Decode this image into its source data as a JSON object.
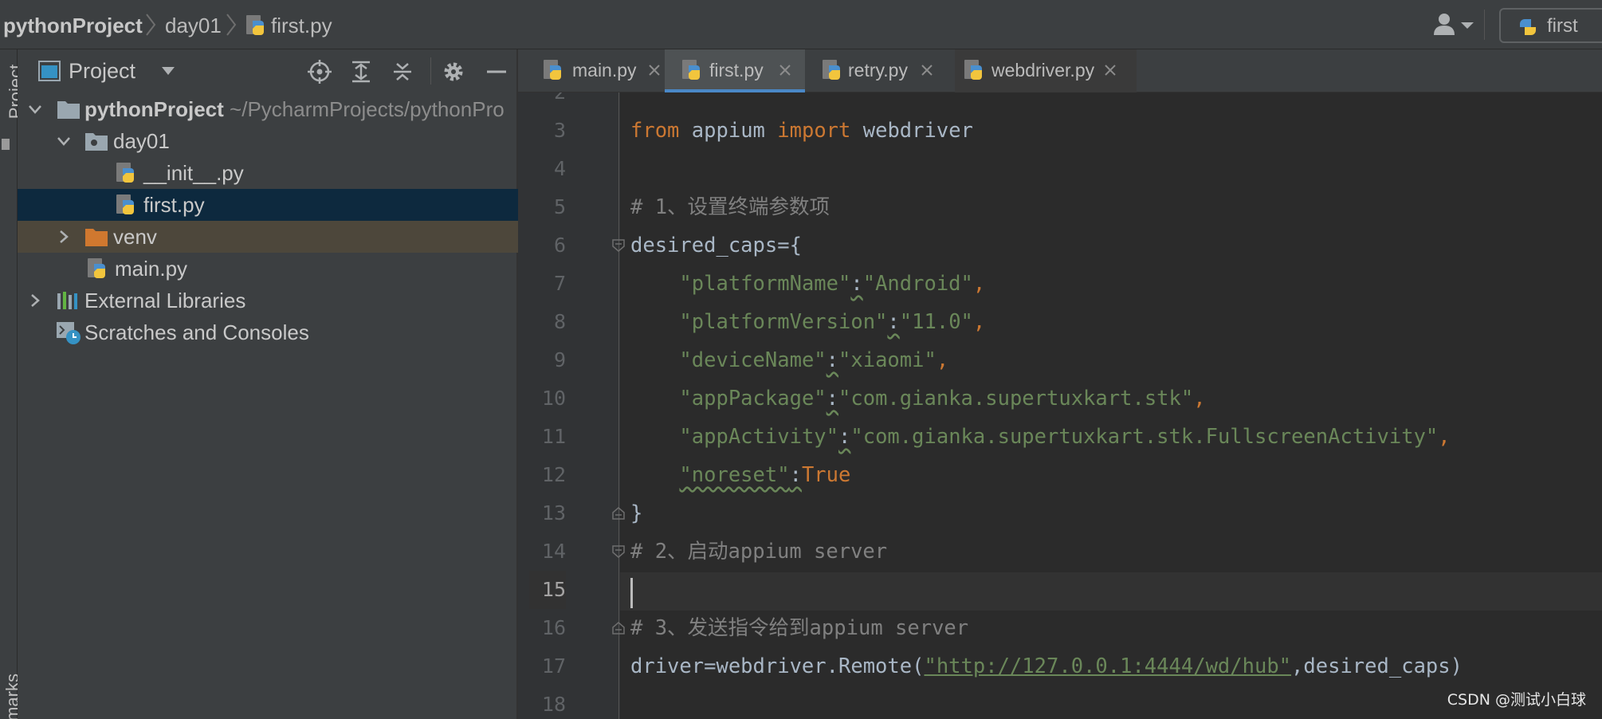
{
  "breadcrumb": {
    "project": "pythonProject",
    "folder": "day01",
    "file": "first.py"
  },
  "run_config": {
    "label": "first"
  },
  "left_stripe": {
    "project_label": "Project",
    "bookmarks_label": "marks"
  },
  "project_panel": {
    "title": "Project",
    "tree": [
      {
        "label": "pythonProject",
        "path": "~/PycharmProjects/pythonPro"
      },
      {
        "label": "day01"
      },
      {
        "label": "__init__.py"
      },
      {
        "label": "first.py"
      },
      {
        "label": "venv"
      },
      {
        "label": "main.py"
      },
      {
        "label": "External Libraries"
      },
      {
        "label": "Scratches and Consoles"
      }
    ]
  },
  "tabs": [
    {
      "label": "main.py"
    },
    {
      "label": "first.py"
    },
    {
      "label": "retry.py"
    },
    {
      "label": "webdriver.py"
    }
  ],
  "editor": {
    "line_numbers": [
      "2",
      "3",
      "4",
      "5",
      "6",
      "7",
      "8",
      "9",
      "10",
      "11",
      "12",
      "13",
      "14",
      "15",
      "16",
      "17",
      "18"
    ],
    "current_line": "15",
    "code": {
      "from": "from",
      "appium": "appium",
      "import": "import",
      "webdriver": "webdriver",
      "comment1": "# 1、设置终端参数项",
      "dc_open": "desired_caps={",
      "k_platformName": "\"platformName\"",
      "v_platformName": "\"Android\"",
      "k_platformVersion": "\"platformVersion\"",
      "v_platformVersion": "\"11.0\"",
      "k_deviceName": "\"deviceName\"",
      "v_deviceName": "\"xiaomi\"",
      "k_appPackage": "\"appPackage\"",
      "v_appPackage": "\"com.gianka.supertuxkart.stk\"",
      "k_appActivity": "\"appActivity\"",
      "v_appActivity": "\"com.gianka.supertuxkart.stk.FullscreenActivity\"",
      "k_noreset": "\"noreset\"",
      "v_noreset": "True",
      "dc_close": "}",
      "comment2": "# 2、启动appium server",
      "comment3": "# 3、发送指令给到appium server",
      "driver_prefix": "driver=webdriver.Remote(",
      "url": "\"http://127.0.0.1:4444/wd/hub\"",
      "driver_suffix": ",desired_caps)"
    }
  },
  "watermark": "CSDN @测试小白球",
  "colors": {
    "keyword": "#cc7832",
    "string": "#6a8759",
    "comment": "#808080",
    "text": "#a9b7c6",
    "selection": "#0d293e",
    "tab_accent": "#4a88c7"
  }
}
